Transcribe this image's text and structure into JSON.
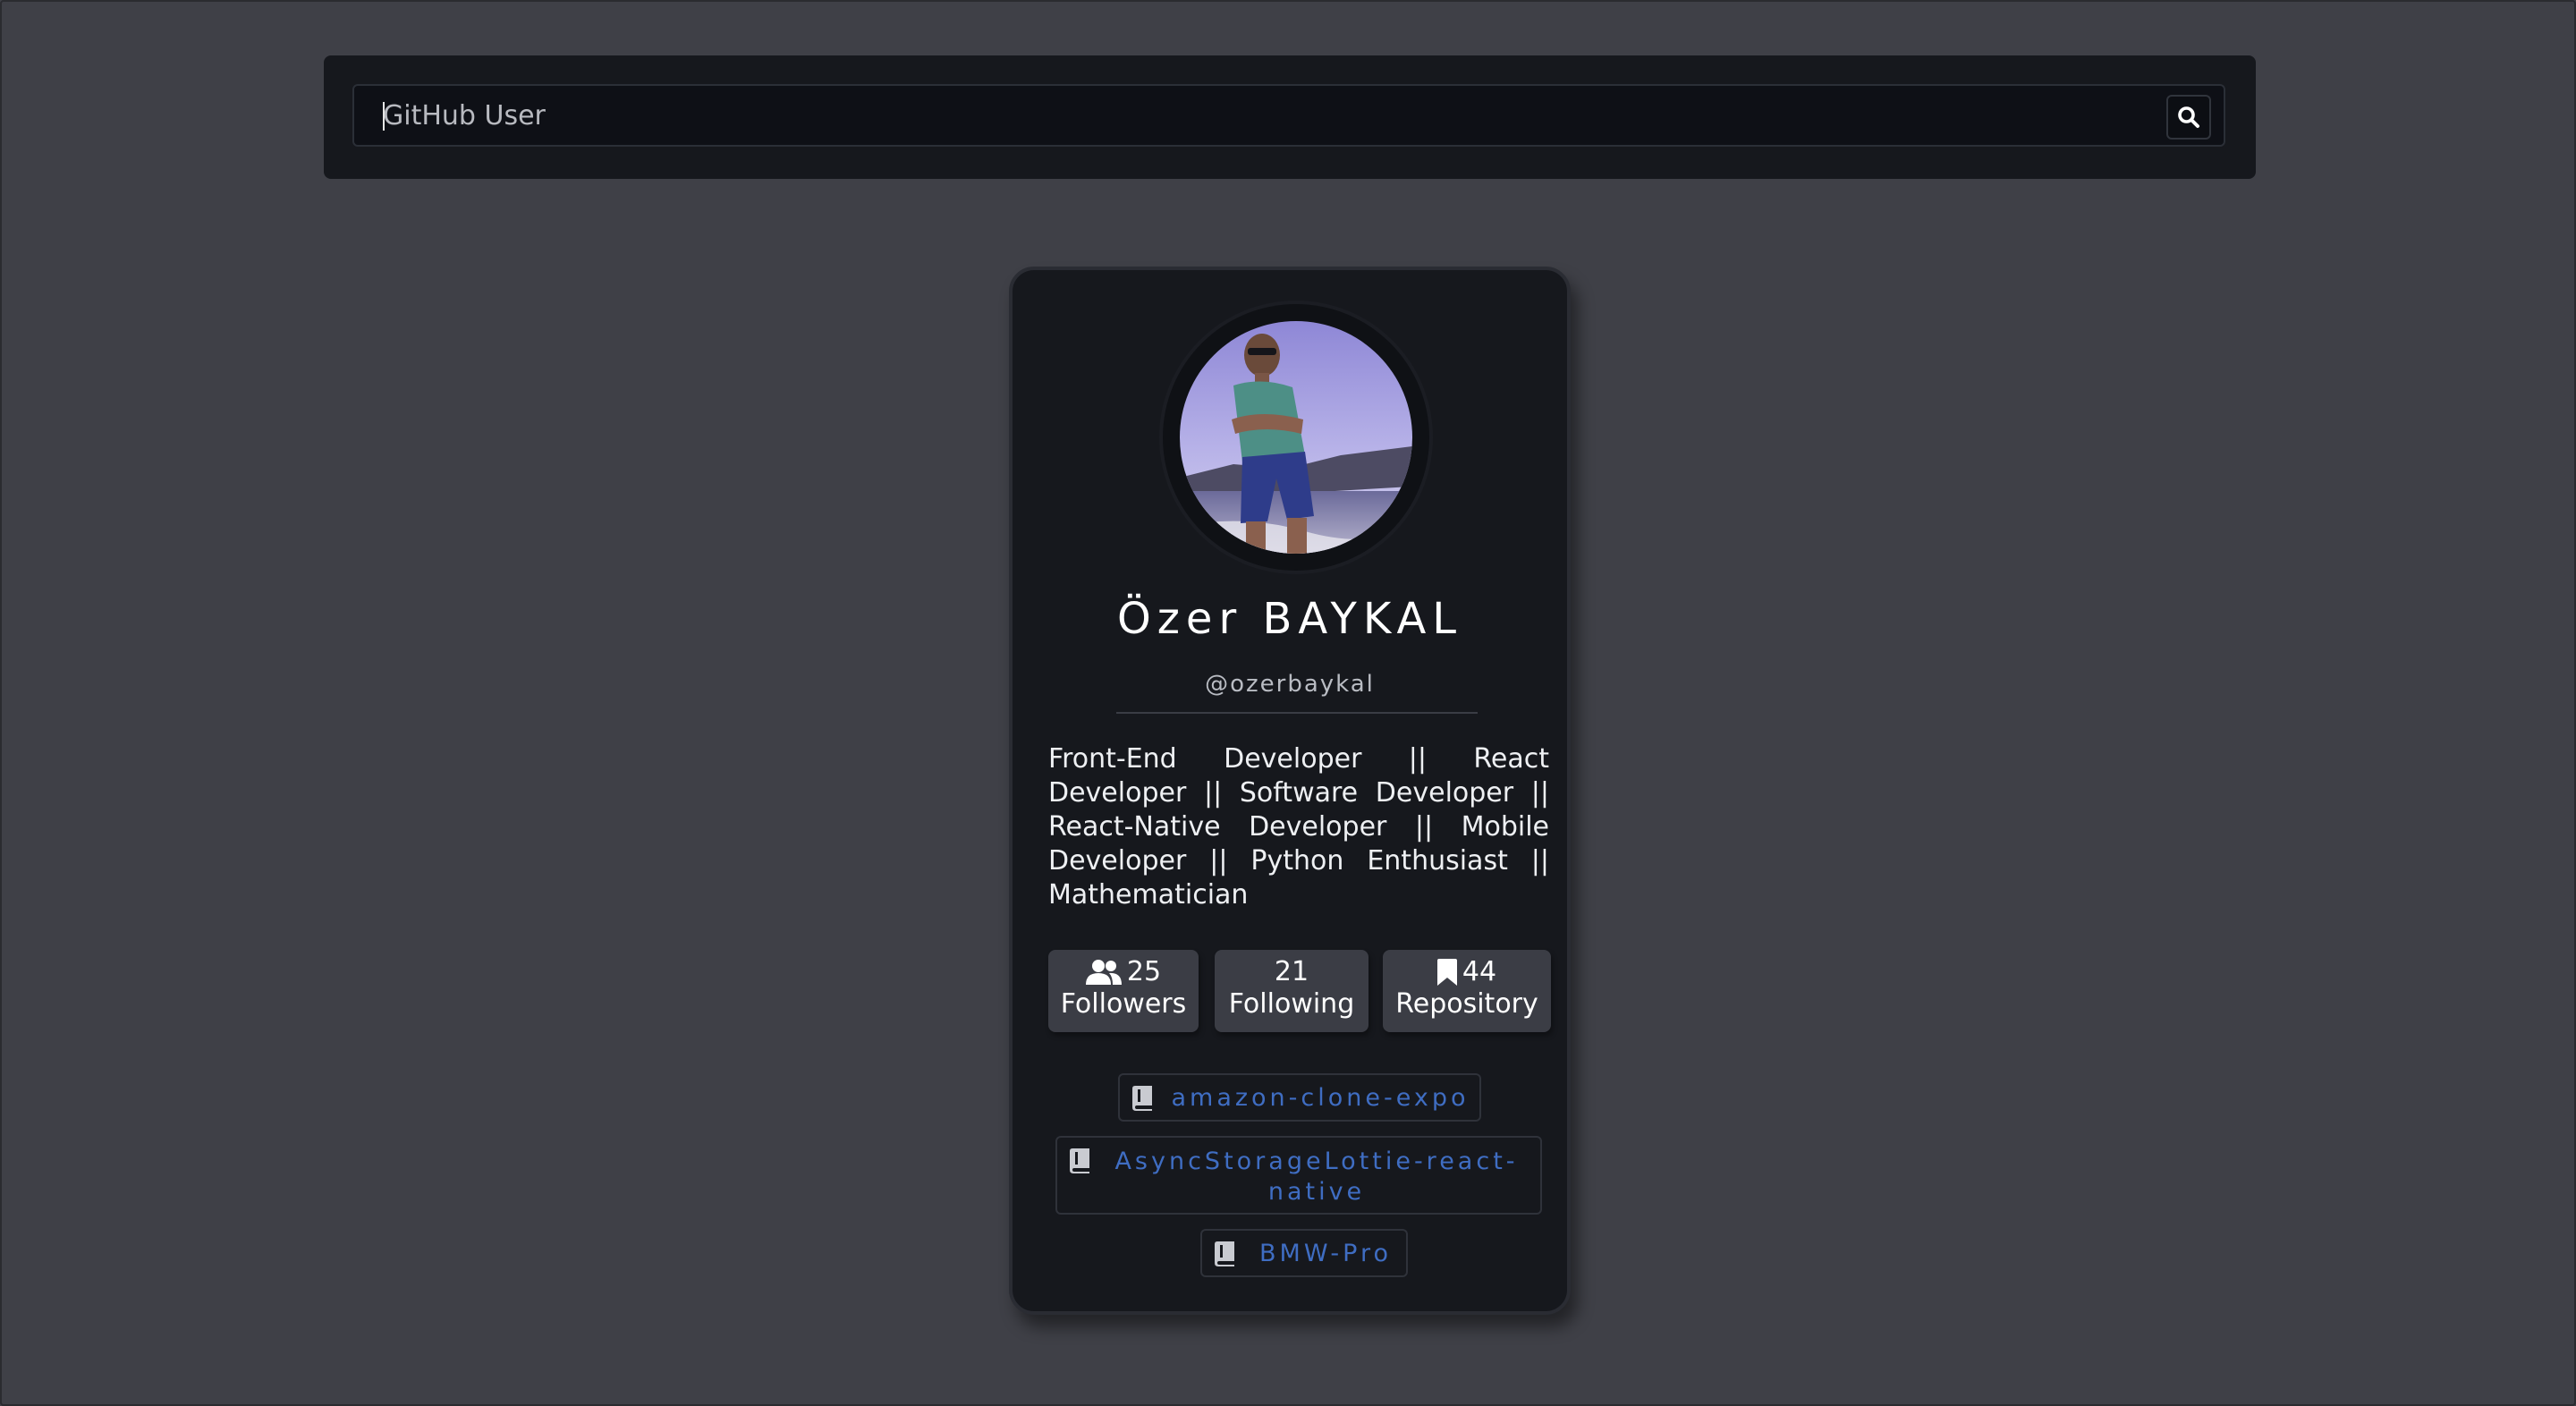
{
  "search": {
    "placeholder": "GitHub User",
    "button_icon": "search-icon"
  },
  "profile": {
    "name": "Özer BAYKAL",
    "login": "@ozerbaykal",
    "bio": "Front-End Developer || React Developer || Software Developer || React-Native Developer || Mobile Developer || Python Enthusiast || Mathematician",
    "avatar_icon": "avatar-photo"
  },
  "stats": {
    "followers": {
      "count": "25",
      "label": "Followers",
      "icon": "users-icon"
    },
    "following": {
      "count": "21",
      "label": "Following"
    },
    "repository": {
      "count": "44",
      "label": "Repository",
      "icon": "bookmark-icon"
    }
  },
  "repos": [
    {
      "name": "amazon-clone-expo",
      "icon": "repo-book-icon"
    },
    {
      "name": "AsyncStorageLottie-react-native",
      "icon": "repo-book-icon"
    },
    {
      "name": "BMW-Pro",
      "icon": "repo-book-icon"
    }
  ],
  "colors": {
    "background": "#3f4047",
    "card": "#16181d",
    "repo_link": "#3f6dc2",
    "stat_box": "#3b3d45"
  }
}
